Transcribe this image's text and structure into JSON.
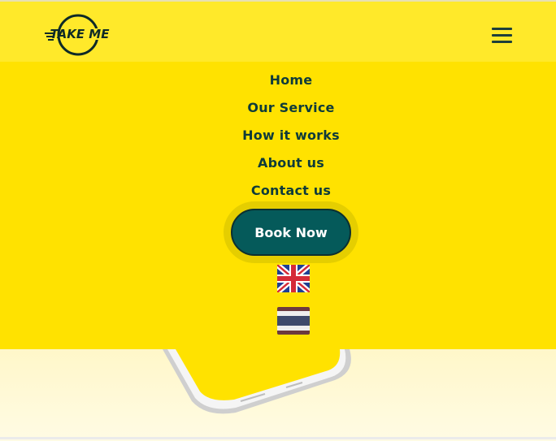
{
  "header": {
    "logo_text": "TAKE ME",
    "menu_icon": "hamburger-menu-icon"
  },
  "nav": {
    "items": [
      {
        "label": "Home"
      },
      {
        "label": "Our Service"
      },
      {
        "label": "How it works"
      },
      {
        "label": "About us"
      },
      {
        "label": "Contact us"
      }
    ],
    "book_label": "Book Now"
  },
  "languages": [
    {
      "icon": "uk-flag-icon"
    },
    {
      "icon": "thailand-flag-icon"
    }
  ],
  "colors": {
    "header_bg": "#ffe92a",
    "menu_bg": "#ffe200",
    "nav_text": "#0e3b3a",
    "button_bg": "#055a5a",
    "button_text": "#ffffff"
  }
}
